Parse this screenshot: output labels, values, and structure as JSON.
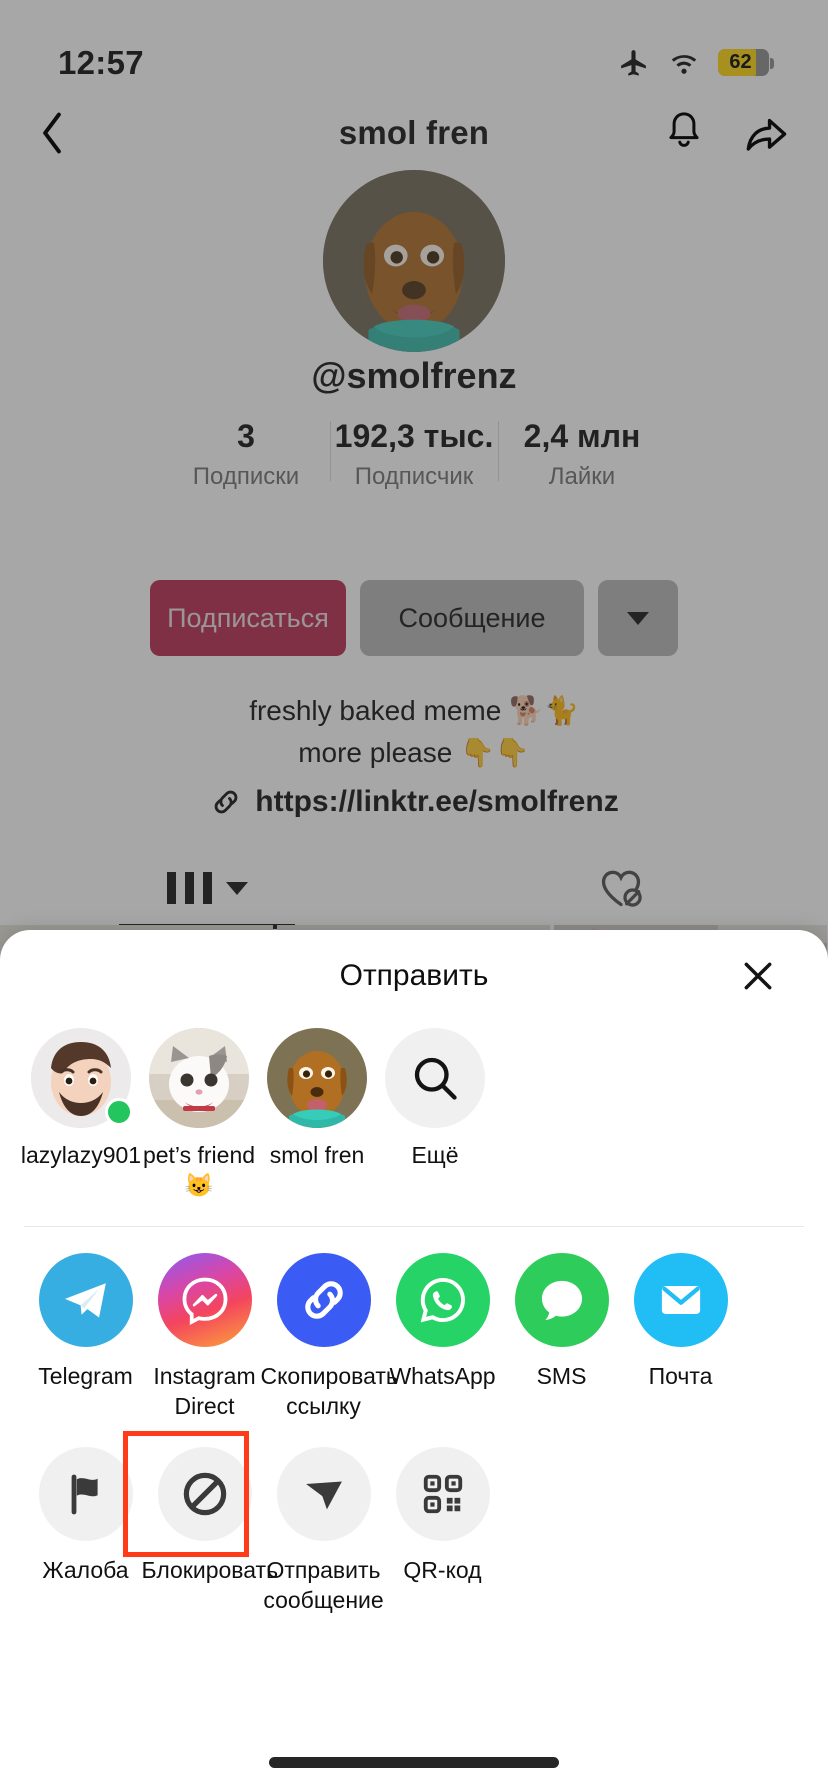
{
  "status_bar": {
    "time": "12:57",
    "icons": [
      "airplane-mode-icon",
      "wifi-icon",
      "battery-icon"
    ],
    "battery_level": "62"
  },
  "nav_bar": {
    "title": "smol fren",
    "back_icon": "chevron-left-icon",
    "notification_icon": "bell-icon",
    "share_icon": "share-arrow-icon"
  },
  "profile": {
    "avatar": "dog-avatar",
    "handle": "@smolfrenz",
    "stats": [
      {
        "value": "3",
        "label": "Подписки"
      },
      {
        "value": "192,3 тыс.",
        "label": "Подписчик"
      },
      {
        "value": "2,4 млн",
        "label": "Лайки"
      }
    ],
    "follow_label": "Подписаться",
    "message_label": "Сообщение",
    "more_icon": "chevron-down-icon",
    "bio_line1": "freshly baked meme 🐕🐈",
    "bio_line2": "more please 👇👇",
    "link_icon": "link-icon",
    "link": "https://linktr.ee/smolfrenz",
    "tabs": [
      {
        "icon": "grid-videos-icon",
        "chevron": "chevron-down-icon",
        "active": true
      },
      {
        "icon": "hidden-likes-icon",
        "active": false
      }
    ]
  },
  "share_sheet": {
    "title": "Отправить",
    "close_icon": "close-icon",
    "contacts": [
      {
        "name": "lazylazy901",
        "avatar": "memoji-avatar",
        "online": true
      },
      {
        "name": "pet’s friend 😺",
        "avatar": "cat-avatar",
        "online": false
      },
      {
        "name": "smol fren",
        "avatar": "dog-avatar",
        "online": false
      },
      {
        "name": "Ещё",
        "avatar": "search-icon",
        "online": false
      }
    ],
    "apps": [
      {
        "label": "Telegram",
        "icon": "telegram-icon",
        "color": "#37AEE2"
      },
      {
        "label": "Instagram Direct",
        "icon": "instagram-direct-icon",
        "color": "#E1306C"
      },
      {
        "label": "Скопировать ссылку",
        "icon": "copy-link-icon",
        "color": "#3B5BF5"
      },
      {
        "label": "WhatsApp",
        "icon": "whatsapp-icon",
        "color": "#25D366"
      },
      {
        "label": "SMS",
        "icon": "sms-icon",
        "color": "#2ECC5A"
      },
      {
        "label": "Почта",
        "icon": "mail-icon",
        "color": "#21BDF5"
      }
    ],
    "actions": [
      {
        "label": "Жалоба",
        "icon": "flag-icon",
        "highlighted": false
      },
      {
        "label": "Блокировать",
        "icon": "block-icon",
        "highlighted": true
      },
      {
        "label": "Отправить сообщение",
        "icon": "send-message-icon",
        "highlighted": false
      },
      {
        "label": "QR-код",
        "icon": "qr-code-icon",
        "highlighted": false
      }
    ],
    "highlight_color": "#FF3B18"
  }
}
